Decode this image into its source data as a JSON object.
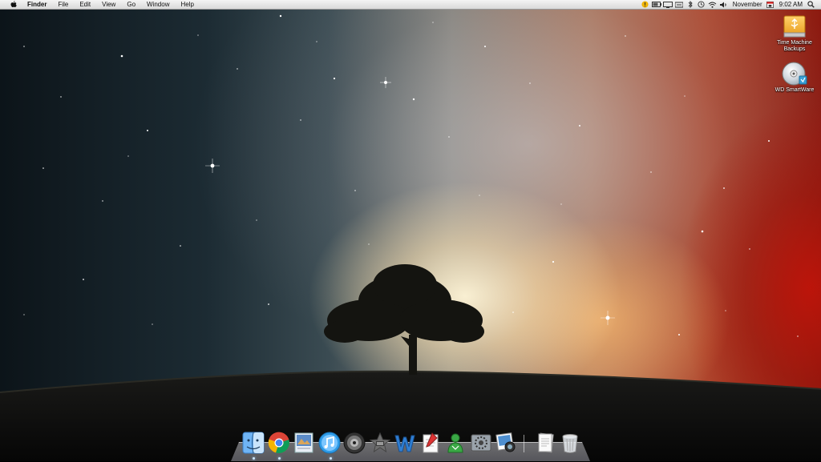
{
  "menubar": {
    "apple_icon": "apple-logo-icon",
    "app_name": "Finder",
    "menus": [
      "File",
      "Edit",
      "View",
      "Go",
      "Window",
      "Help"
    ],
    "status_icons": [
      "warning-icon",
      "battery-icon",
      "display-icon",
      "volume-icon",
      "bluetooth-icon",
      "time-machine-icon",
      "wifi-icon",
      "speaker-icon"
    ],
    "date_text": "November",
    "calendar_icon": "calendar-icon",
    "time_text": "9:02 AM",
    "spotlight_icon": "search-icon"
  },
  "desktop": {
    "icons": [
      {
        "label_line1": "Time Machine",
        "label_line2": "Backups",
        "icon": "external-drive-icon"
      },
      {
        "label_line1": "WD SmartWare",
        "label_line2": "",
        "icon": "cd-disc-icon"
      }
    ]
  },
  "dock": {
    "apps": [
      {
        "icon": "finder-icon",
        "running": true
      },
      {
        "icon": "chrome-icon",
        "running": true
      },
      {
        "icon": "preview-icon",
        "running": false
      },
      {
        "icon": "itunes-icon",
        "running": true
      },
      {
        "icon": "dvd-player-icon",
        "running": false
      },
      {
        "icon": "imovie-icon",
        "running": false
      },
      {
        "icon": "word-icon",
        "running": false
      },
      {
        "icon": "script-editor-icon",
        "running": false
      },
      {
        "icon": "network-icon",
        "running": false
      },
      {
        "icon": "system-preferences-icon",
        "running": false
      },
      {
        "icon": "iphoto-icon",
        "running": false
      }
    ],
    "right": [
      {
        "icon": "documents-stack-icon"
      },
      {
        "icon": "trash-icon"
      }
    ]
  },
  "colors": {
    "menubar_bg": "#e6e6e6",
    "sky_left": "#1c2b33",
    "sky_right": "#8c1a10",
    "glow": "#fff5d7"
  }
}
